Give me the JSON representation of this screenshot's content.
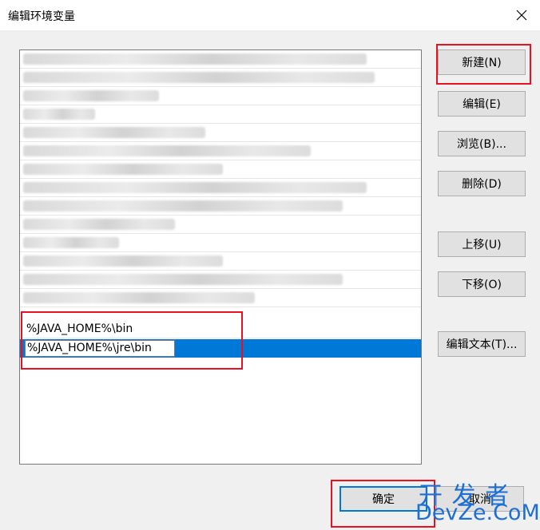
{
  "window": {
    "title": "编辑环境变量",
    "close_icon": "close-icon"
  },
  "list": {
    "items": [
      {
        "text": ""
      },
      {
        "text": ""
      },
      {
        "text": ""
      },
      {
        "text": ""
      },
      {
        "text": ""
      },
      {
        "text": ""
      },
      {
        "text": ""
      },
      {
        "text": ""
      },
      {
        "text": ""
      },
      {
        "text": ""
      },
      {
        "text": ""
      },
      {
        "text": ""
      },
      {
        "text": ""
      },
      {
        "text": ""
      },
      {
        "text": "%JAVA_HOME%\\bin"
      },
      {
        "text": "%JAVA_HOME%\\jre\\bin",
        "editing": true
      }
    ]
  },
  "buttons": {
    "new": "新建(N)",
    "edit": "编辑(E)",
    "browse": "浏览(B)...",
    "delete": "删除(D)",
    "move_up": "上移(U)",
    "move_down": "下移(O)",
    "edit_text": "编辑文本(T)...",
    "ok": "确定",
    "cancel": "取消"
  },
  "watermark": {
    "line1": "开 发 者",
    "line2": "DevZe.CoM"
  },
  "colors": {
    "selection": "#0078d7",
    "highlight": "#e81123",
    "button": "#e1e1e1"
  }
}
